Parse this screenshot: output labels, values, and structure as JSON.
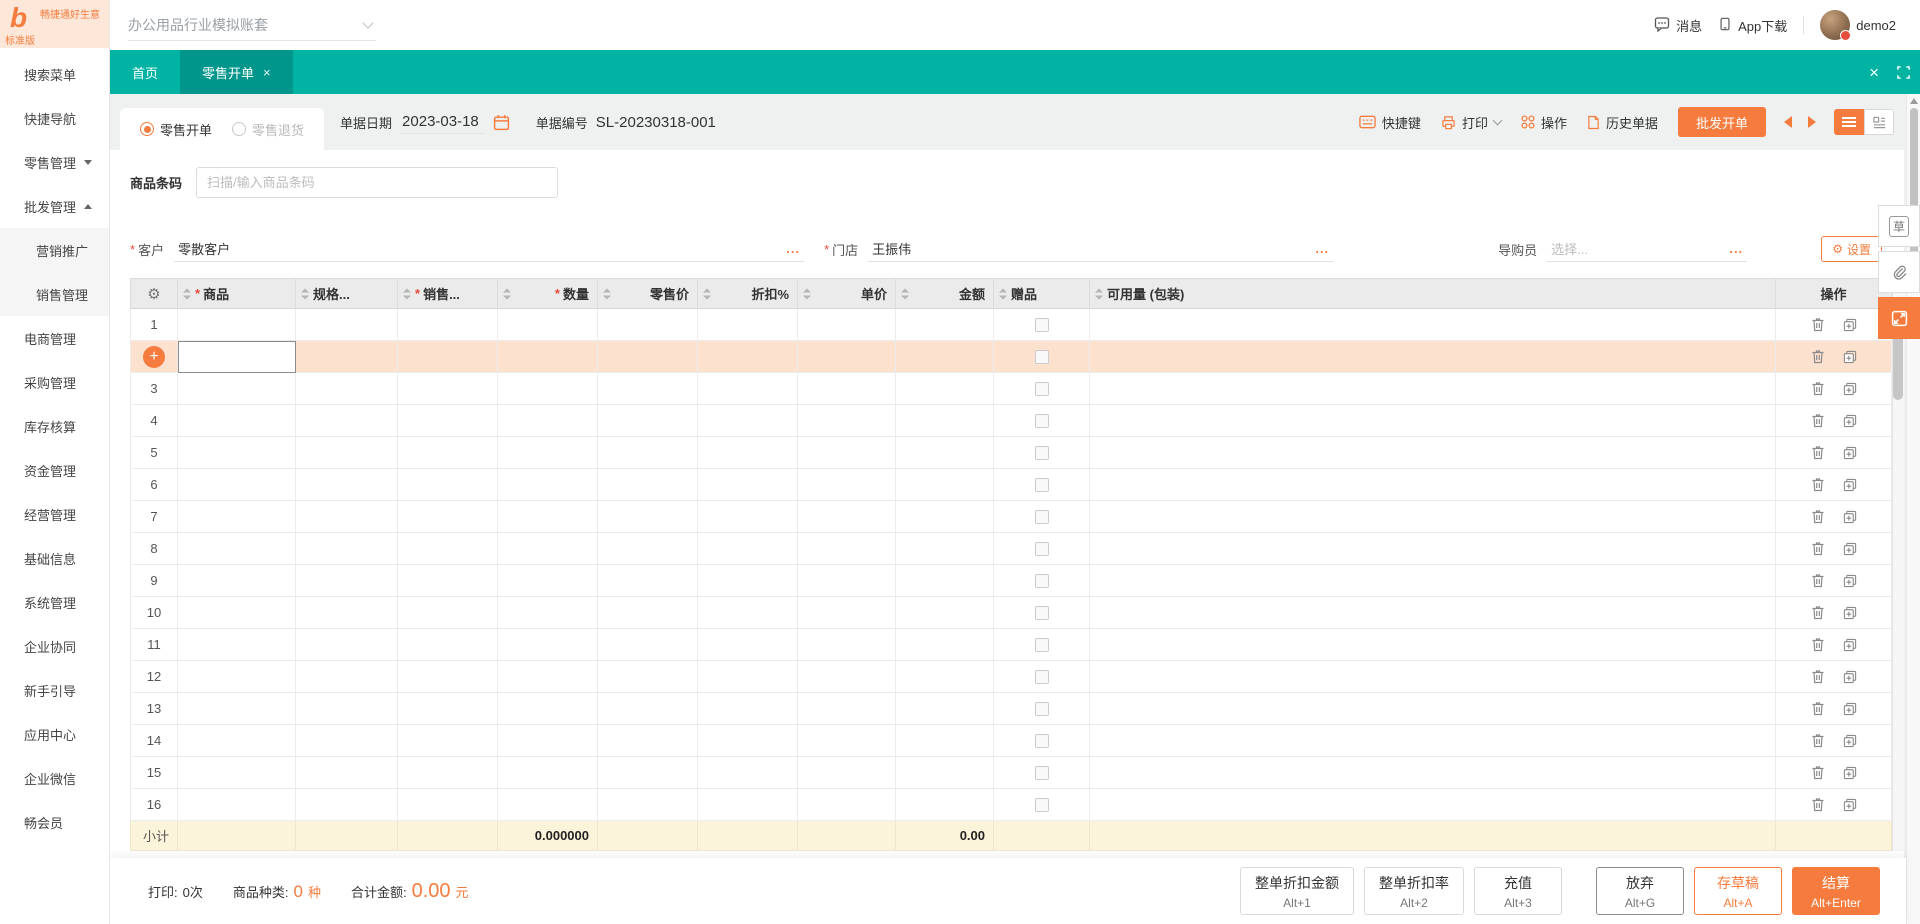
{
  "brand": {
    "name": "畅捷通好生意",
    "edition": "标准版"
  },
  "topbar": {
    "account_set": "办公用品行业模拟账套",
    "messages": "消息",
    "app_download": "App下载",
    "username": "demo2"
  },
  "sidebar": {
    "items": [
      {
        "label": "搜索菜单"
      },
      {
        "label": "快捷导航"
      },
      {
        "label": "零售管理",
        "caret": "down"
      },
      {
        "label": "批发管理",
        "caret": "up"
      },
      {
        "label": "营销推广",
        "submenu": true
      },
      {
        "label": "销售管理",
        "submenu": true
      },
      {
        "label": "电商管理"
      },
      {
        "label": "采购管理"
      },
      {
        "label": "库存核算"
      },
      {
        "label": "资金管理"
      },
      {
        "label": "经营管理"
      },
      {
        "label": "基础信息"
      },
      {
        "label": "系统管理"
      },
      {
        "label": "企业协同"
      },
      {
        "label": "新手引导"
      },
      {
        "label": "应用中心"
      },
      {
        "label": "企业微信"
      },
      {
        "label": "畅会员"
      }
    ]
  },
  "tabs": [
    {
      "label": "首页",
      "active": false,
      "closable": false
    },
    {
      "label": "零售开单",
      "active": true,
      "closable": true
    }
  ],
  "doc": {
    "types": [
      {
        "label": "零售开单",
        "selected": true
      },
      {
        "label": "零售退货",
        "selected": false
      }
    ],
    "date_label": "单据日期",
    "date_value": "2023-03-18",
    "no_label": "单据编号",
    "no_value": "SL-20230318-001",
    "actions": {
      "hotkeys": "快捷键",
      "print": "打印",
      "ops": "操作",
      "history": "历史单据",
      "wholesale": "批发开单"
    }
  },
  "barcode": {
    "label": "商品条码",
    "placeholder": "扫描/输入商品条码"
  },
  "fields": {
    "customer": {
      "label": "客户",
      "value": "零散客户"
    },
    "store": {
      "label": "门店",
      "value": "王振伟"
    },
    "guide": {
      "label": "导购员",
      "placeholder": "选择..."
    },
    "settings": "设置"
  },
  "table": {
    "columns": [
      {
        "label": "",
        "type": "gear"
      },
      {
        "label": "商品",
        "required": true,
        "align": "left"
      },
      {
        "label": "规格...",
        "align": "left"
      },
      {
        "label": "销售...",
        "required": true,
        "align": "left"
      },
      {
        "label": "数量",
        "required": true,
        "align": "right"
      },
      {
        "label": "零售价",
        "align": "right"
      },
      {
        "label": "折扣%",
        "align": "right"
      },
      {
        "label": "单价",
        "align": "right"
      },
      {
        "label": "金额",
        "align": "right"
      },
      {
        "label": "赠品",
        "align": "left",
        "type": "checkbox"
      },
      {
        "label": "可用量 (包装)",
        "align": "left"
      },
      {
        "label": "操作",
        "align": "center",
        "type": "ops"
      }
    ],
    "row_count": 16,
    "active_row": 2,
    "subtotal": {
      "label": "小计",
      "qty": "0.000000",
      "amount": "0.00"
    }
  },
  "footer": {
    "stats": {
      "print_label": "打印:",
      "print_value": "0次",
      "kinds_label": "商品种类:",
      "kinds_value": "0",
      "kinds_unit": "种",
      "total_label": "合计金额:",
      "total_value": "0.00",
      "total_unit": "元"
    },
    "buttons": [
      {
        "label": "整单折扣金额",
        "hotkey": "Alt+1",
        "variant": "default"
      },
      {
        "label": "整单折扣率",
        "hotkey": "Alt+2",
        "variant": "default"
      },
      {
        "label": "充值",
        "hotkey": "Alt+3",
        "variant": "default"
      },
      {
        "label": "放弃",
        "hotkey": "Alt+G",
        "variant": "bordered"
      },
      {
        "label": "存草稿",
        "hotkey": "Alt+A",
        "variant": "outline"
      },
      {
        "label": "结算",
        "hotkey": "Alt+Enter",
        "variant": "primary"
      }
    ]
  },
  "icons": {
    "gear": "⚙",
    "close": "×",
    "ellipsis": "...",
    "plus": "+",
    "required": "*",
    "draft": "草"
  },
  "colors": {
    "accent": "#f57c3e",
    "teal": "#00b3a3",
    "teal_active": "#00968b",
    "row_highlight": "#fce1cf",
    "subtotal_bg": "#fcf4da"
  }
}
